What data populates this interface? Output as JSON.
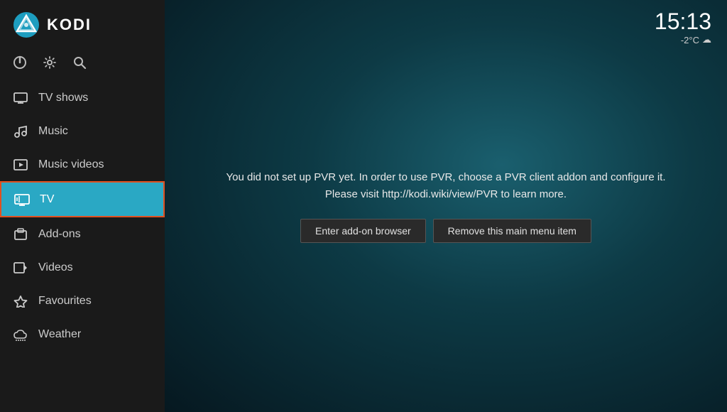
{
  "app": {
    "title": "KODI"
  },
  "clock": {
    "time": "15:13",
    "temp": "-2°C",
    "weather_icon": "☁"
  },
  "sidebar": {
    "icons": [
      {
        "name": "power-icon",
        "glyph": "⏻",
        "label": "Power"
      },
      {
        "name": "settings-icon",
        "glyph": "⚙",
        "label": "Settings"
      },
      {
        "name": "search-icon",
        "glyph": "🔍",
        "label": "Search"
      }
    ],
    "nav_items": [
      {
        "id": "tv-shows",
        "label": "TV shows",
        "icon": "📺",
        "active": false
      },
      {
        "id": "music",
        "label": "Music",
        "icon": "🎧",
        "active": false
      },
      {
        "id": "music-videos",
        "label": "Music videos",
        "icon": "🎞",
        "active": false
      },
      {
        "id": "tv",
        "label": "TV",
        "icon": "📡",
        "active": true
      },
      {
        "id": "add-ons",
        "label": "Add-ons",
        "icon": "🎁",
        "active": false
      },
      {
        "id": "videos",
        "label": "Videos",
        "icon": "🎬",
        "active": false
      },
      {
        "id": "favourites",
        "label": "Favourites",
        "icon": "⭐",
        "active": false
      },
      {
        "id": "weather",
        "label": "Weather",
        "icon": "🌩",
        "active": false
      }
    ]
  },
  "pvr": {
    "message_line1": "You did not set up PVR yet. In order to use PVR, choose a PVR client addon and configure it.",
    "message_line2": "Please visit http://kodi.wiki/view/PVR to learn more.",
    "btn_addon_browser": "Enter add-on browser",
    "btn_remove_menu": "Remove this main menu item"
  }
}
